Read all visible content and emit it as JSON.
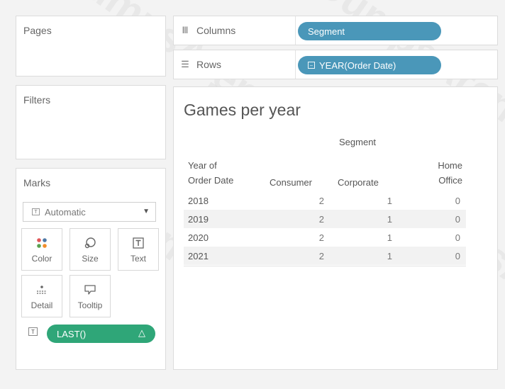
{
  "pages": {
    "title": "Pages"
  },
  "filters": {
    "title": "Filters"
  },
  "shelves": {
    "columns": {
      "label": "Columns",
      "icon": "columns-icon",
      "pill": "Segment"
    },
    "rows": {
      "label": "Rows",
      "icon": "rows-icon",
      "pill": "YEAR(Order Date)"
    }
  },
  "marks": {
    "title": "Marks",
    "mark_type": "Automatic",
    "buttons": [
      {
        "label": "Color",
        "icon": "color-icon"
      },
      {
        "label": "Size",
        "icon": "size-icon"
      },
      {
        "label": "Text",
        "icon": "text-icon"
      },
      {
        "label": "Detail",
        "icon": "detail-icon"
      },
      {
        "label": "Tooltip",
        "icon": "tooltip-icon"
      }
    ],
    "pill": "LAST()"
  },
  "view": {
    "title": "Games per year",
    "column_group_header": "Segment",
    "row_header": [
      "Year of",
      "Order Date"
    ],
    "columns": [
      "Consumer",
      "Corporate",
      "Home Office"
    ],
    "rows": [
      {
        "year": "2018",
        "values": [
          "2",
          "1",
          "0"
        ]
      },
      {
        "year": "2019",
        "values": [
          "2",
          "1",
          "0"
        ]
      },
      {
        "year": "2020",
        "values": [
          "2",
          "1",
          "0"
        ]
      },
      {
        "year": "2021",
        "values": [
          "2",
          "1",
          "0"
        ]
      }
    ]
  },
  "colors": {
    "blue_pill": "#4a97b9",
    "green_pill": "#2fa678"
  }
}
